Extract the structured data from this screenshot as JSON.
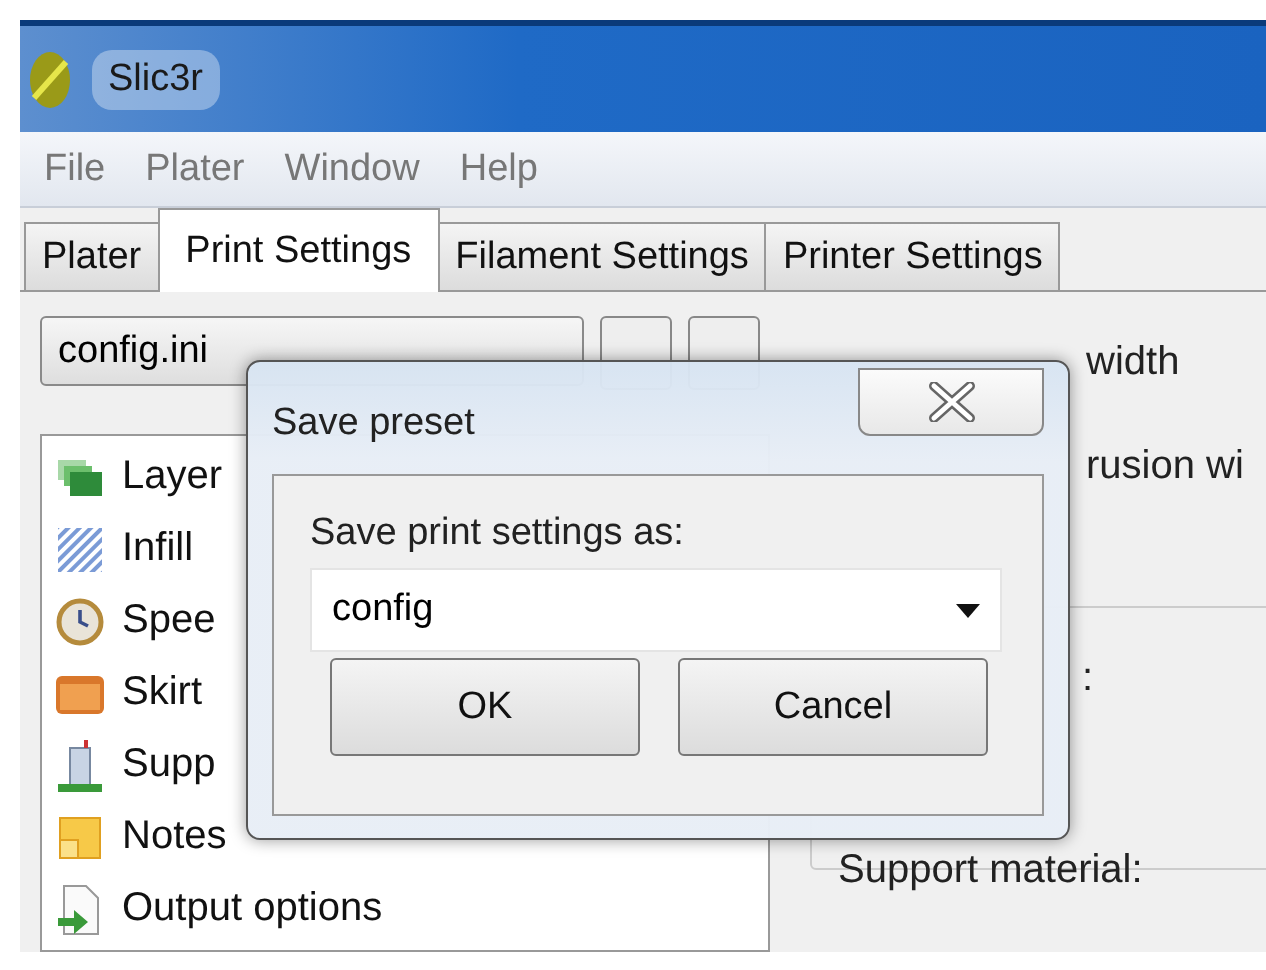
{
  "window": {
    "title": "Slic3r"
  },
  "menu": [
    "File",
    "Plater",
    "Window",
    "Help"
  ],
  "tabs": [
    {
      "label": "Plater",
      "selected": false
    },
    {
      "label": "Print Settings",
      "selected": true
    },
    {
      "label": "Filament Settings",
      "selected": false
    },
    {
      "label": "Printer Settings",
      "selected": false
    }
  ],
  "preset_combo": {
    "value": "config.ini"
  },
  "sections": [
    {
      "label": "Layer"
    },
    {
      "label": "Infill"
    },
    {
      "label": "Spee"
    },
    {
      "label": "Skirt"
    },
    {
      "label": "Supp"
    },
    {
      "label": "Notes"
    },
    {
      "label": "Output options"
    }
  ],
  "options": [
    {
      "label": "width"
    },
    {
      "label": "rusion wi"
    },
    {
      "label": ":"
    },
    {
      "label": "Support material:"
    }
  ],
  "dialog": {
    "title": "Save preset",
    "prompt": "Save print settings as:",
    "value": "config",
    "buttons": [
      "OK",
      "Cancel"
    ]
  }
}
